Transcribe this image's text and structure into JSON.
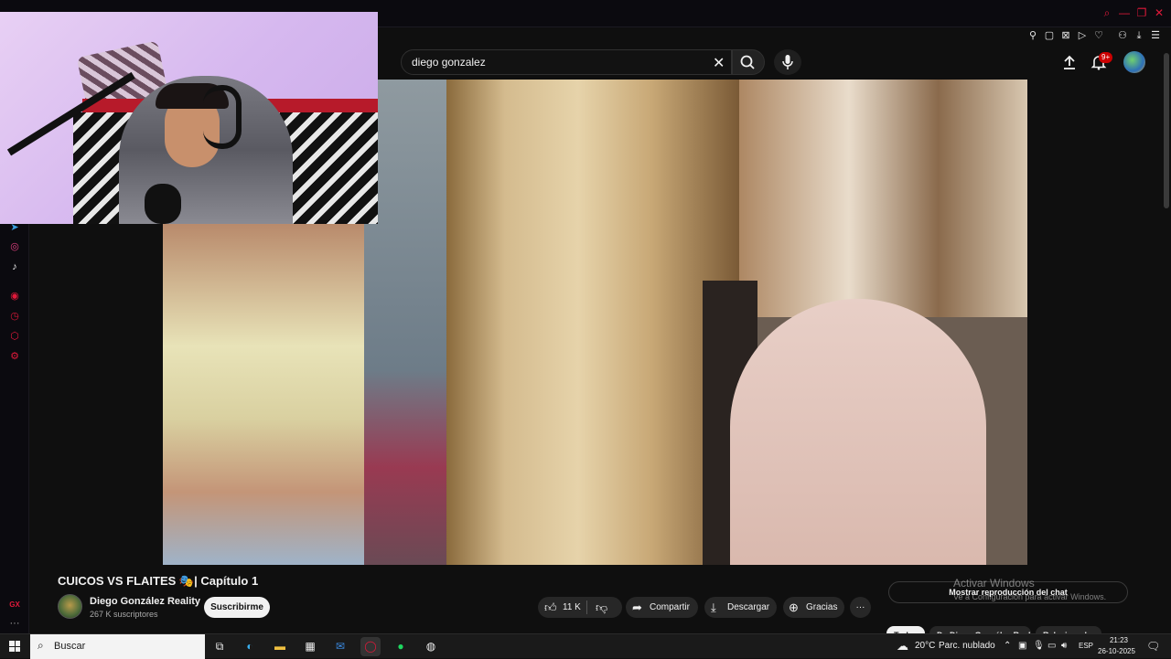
{
  "browser": {
    "accent_color": "#e0193a",
    "window_controls": [
      "search-icon",
      "minimize-icon",
      "restore-icon",
      "close-icon"
    ],
    "extensions": [
      "pin-icon",
      "snapshot-icon",
      "shield-icon",
      "play-icon",
      "heart-icon",
      "account-icon",
      "download-icon",
      "menu-icon"
    ]
  },
  "sidebar": {
    "icons": [
      "telegram-icon",
      "instagram-icon",
      "tiktok-icon",
      "player-icon",
      "history-icon",
      "extensions-icon",
      "settings-icon"
    ],
    "bottom_label": "GX",
    "more": "···"
  },
  "header": {
    "search_value": "diego gonzalez",
    "notification_badge": "9+"
  },
  "video": {
    "title": "CUICOS VS FLAITES 🎭| Capítulo 1",
    "channel_name": "Diego González Reality",
    "subscribers": "267 K suscriptores",
    "subscribe_label": "Suscribirme",
    "like_count": "11 K",
    "share_label": "Compartir",
    "download_label": "Descargar",
    "thanks_label": "Gracias",
    "more_label": "···"
  },
  "chat": {
    "replay_label": "Mostrar reproducción del chat"
  },
  "chips": [
    "Todos",
    "De Diego González Reality",
    "Relacionados"
  ],
  "watermark": {
    "line1": "Activar Windows",
    "line2": "Ve a Configuración para activar Windows."
  },
  "taskbar": {
    "search_placeholder": "Buscar",
    "temperature": "20°C",
    "weather": "Parc. nublado",
    "language": "ESP",
    "time": "21:23",
    "date": "26-10-2025"
  }
}
